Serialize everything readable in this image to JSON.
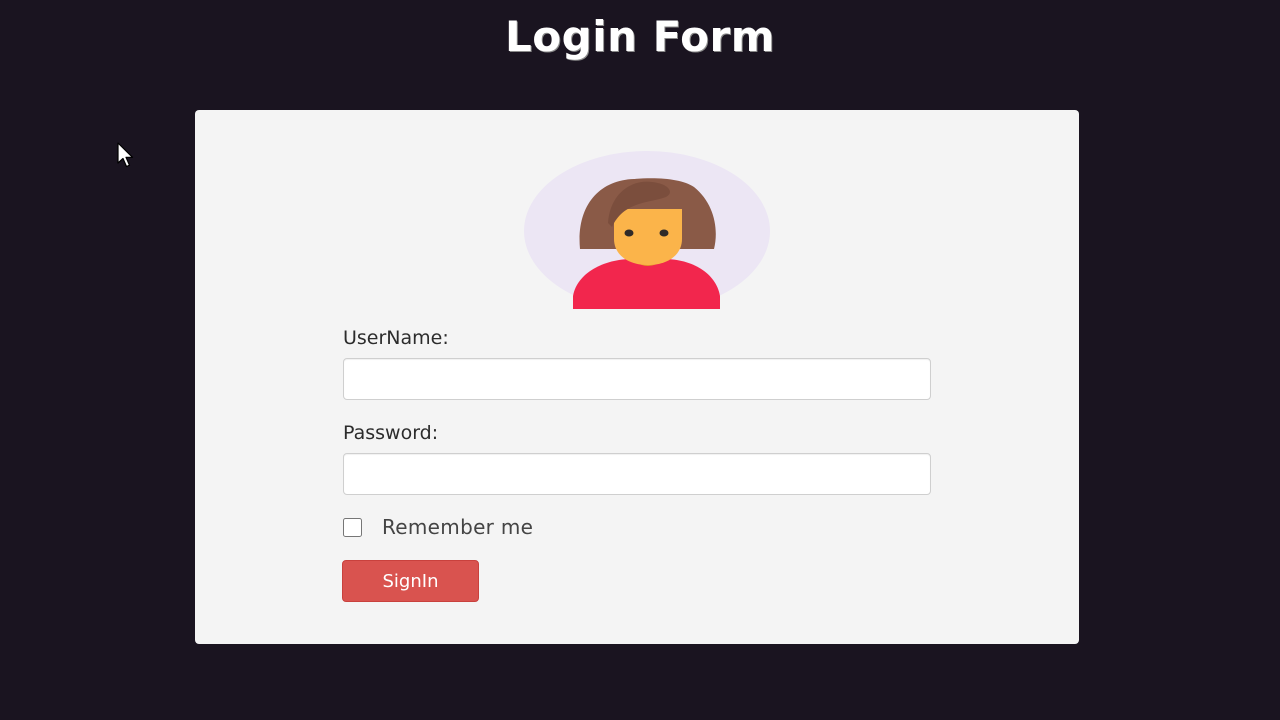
{
  "header": {
    "title": "Login Form"
  },
  "form": {
    "avatar_icon": "user-avatar-woman-icon",
    "username_label": "UserName:",
    "username_value": "",
    "password_label": "Password:",
    "password_value": "",
    "remember_label": "Remember me",
    "remember_checked": false,
    "submit_label": "SignIn"
  },
  "colors": {
    "page_background": "#1a1420",
    "card_background": "#f4f4f4",
    "avatar_circle": "#ece6f4",
    "submit_button": "#d9534f"
  }
}
